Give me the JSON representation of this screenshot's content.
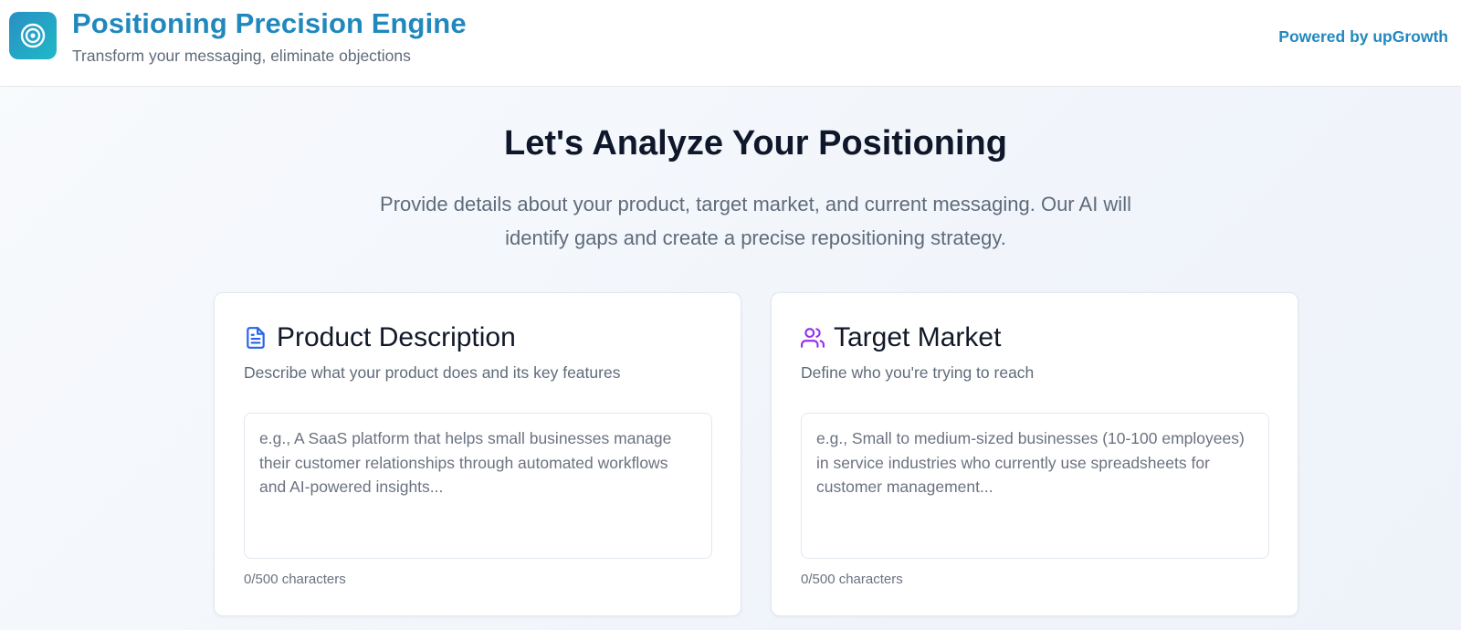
{
  "header": {
    "title": "Positioning Precision Engine",
    "subtitle": "Transform your messaging, eliminate objections",
    "powered_by": "Powered by upGrowth",
    "logo_icon": "target-icon"
  },
  "hero": {
    "title": "Let's Analyze Your Positioning",
    "description": "Provide details about your product, target market, and current messaging. Our AI will identify gaps and create a precise repositioning strategy."
  },
  "cards": [
    {
      "icon": "document-icon",
      "icon_color": "#2563eb",
      "title": "Product Description",
      "description": "Describe what your product does and its key features",
      "value": "",
      "placeholder": "e.g., A SaaS platform that helps small businesses manage their customer relationships through automated workflows and AI-powered insights...",
      "char_count": "0/500 characters"
    },
    {
      "icon": "users-icon",
      "icon_color": "#9333ea",
      "title": "Target Market",
      "description": "Define who you're trying to reach",
      "value": "",
      "placeholder": "e.g., Small to medium-sized businesses (10-100 employees) in service industries who currently use spreadsheets for customer management...",
      "char_count": "0/500 characters"
    }
  ],
  "colors": {
    "brand": "#2188be",
    "heading": "#0f172a",
    "muted": "#5f6b7a"
  }
}
